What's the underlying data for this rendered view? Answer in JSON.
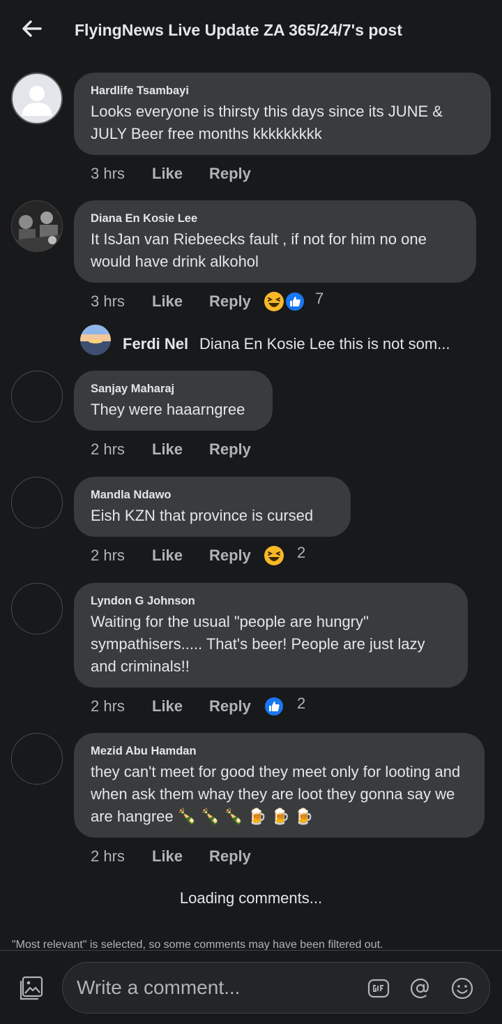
{
  "header": {
    "title": "FlyingNews Live Update ZA 365/24/7's post"
  },
  "comments": [
    {
      "author": "Hardlife Tsambayi",
      "text": "Looks everyone is thirsty this days since its JUNE & JULY Beer free months kkkkkkkkk",
      "time": "3 hrs",
      "like_label": "Like",
      "reply_label": "Reply",
      "avatar": "default-profile"
    },
    {
      "author": "Diana En Kosie Lee",
      "text": "It IsJan van Riebeecks fault , if not for him no one would have drink alkohol",
      "time": "3 hrs",
      "like_label": "Like",
      "reply_label": "Reply",
      "reaction_count": "7",
      "reactions": [
        "haha-icon",
        "like-icon"
      ],
      "avatar": "photo"
    },
    {
      "author": "Sanjay Maharaj",
      "text": "They were haaarngree",
      "time": "2 hrs",
      "like_label": "Like",
      "reply_label": "Reply",
      "avatar": "empty"
    },
    {
      "author": "Mandla Ndawo",
      "text": "Eish KZN that province is cursed",
      "time": "2 hrs",
      "like_label": "Like",
      "reply_label": "Reply",
      "reaction_count": "2",
      "reactions": [
        "haha-icon"
      ],
      "avatar": "empty"
    },
    {
      "author": "Lyndon G Johnson",
      "text": "Waiting for the usual \"people are hungry\" sympathisers..... That's beer! People are just lazy and criminals!!",
      "time": "2 hrs",
      "like_label": "Like",
      "reply_label": "Reply",
      "reaction_count": "2",
      "reactions": [
        "like-icon"
      ],
      "avatar": "empty"
    },
    {
      "author": "Mezid Abu Hamdan",
      "text": "they can't meet for good they meet only for looting and when ask them whay they are loot they gonna say we are hangree 🍾 🍾 🍾 🍺 🍺 🍺",
      "time": "2 hrs",
      "like_label": "Like",
      "reply_label": "Reply",
      "avatar": "empty"
    }
  ],
  "reply_preview": {
    "author": "Ferdi Nel",
    "text": "Diana En Kosie Lee this is not som..."
  },
  "loading_text": "Loading comments...",
  "filter_notice": "\"Most relevant\" is selected, so some comments may have been filtered out.",
  "composer": {
    "placeholder": "Write a comment..."
  },
  "colors": {
    "background": "#18191a",
    "bubble": "#3a3b3c",
    "text_primary": "#e4e6eb",
    "text_secondary": "#b0b3b8",
    "like_blue": "#1877f2",
    "haha_yellow": "#f7b928"
  }
}
